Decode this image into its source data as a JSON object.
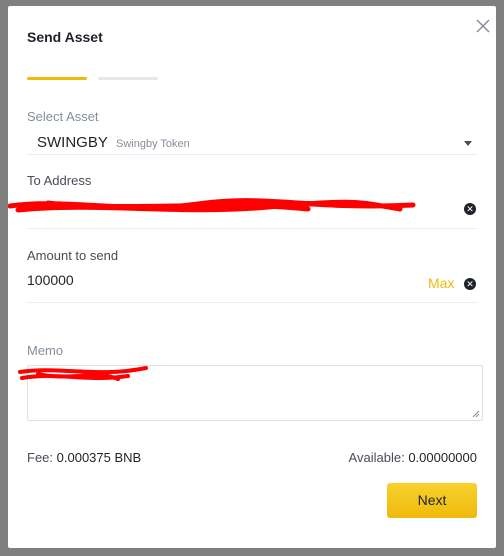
{
  "dialog": {
    "title": "Send Asset",
    "steps": 2,
    "current_step": 1
  },
  "select_asset": {
    "label": "Select Asset",
    "symbol": "SWINGBY",
    "name": "Swingby Token"
  },
  "to_address": {
    "label": "To Address"
  },
  "amount": {
    "label": "Amount to send",
    "value": "100000",
    "max_label": "Max"
  },
  "memo": {
    "label": "Memo"
  },
  "fee": {
    "label": "Fee:",
    "value": "0.000375 BNB"
  },
  "available": {
    "label": "Available:",
    "value": "0.00000000"
  },
  "actions": {
    "next_label": "Next"
  },
  "colors": {
    "accent": "#f0b90b",
    "redaction": "#ff0000",
    "overlay": "#7f7f7f"
  }
}
